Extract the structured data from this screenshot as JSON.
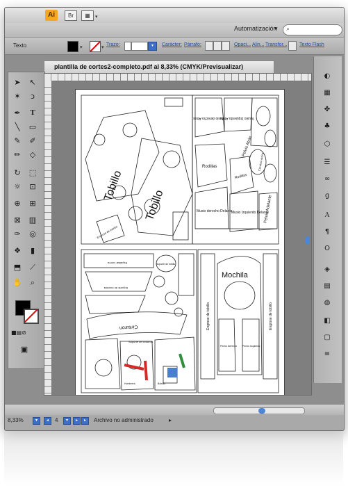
{
  "app": {
    "logo": "Ai",
    "br_label": "Br"
  },
  "menubar": {
    "workspace": "Automatización",
    "workspace_arrow": "▾"
  },
  "controlbar": {
    "context_label": "Texto",
    "stroke_label": "Trazo:",
    "character_label": "Carácter:",
    "paragraph_label": "Párrafo:",
    "opacity_label": "Opaci...",
    "align_label": "Alin...",
    "transform_label": "Transfor...",
    "flash_label": "Texto Flash"
  },
  "document": {
    "tab_title": "plantilla de cortes2-completo.pdf al 8,33% (CMYK/Previsualizar)"
  },
  "artboard_labels": {
    "tobillo_1": "Tobillo",
    "tobillo_2": "Tobillo",
    "engrose_estribo": "Engrose de estribo",
    "musio_derecho_atras": "Musio derecho Atras",
    "musio_izquierdo_atras": "Musio Izquierdo Atras",
    "pelvis_atras": "Pelvis Atrás",
    "circulos_vacios": "Circulos vacios",
    "rodillas_1": "Rodillas",
    "rodillas_2": "Rodillas",
    "pelvis_adelante": "Pelvis Adelante",
    "musio_derecho_delante": "Musio derecho Delante",
    "musio_izquierdo_delante": "Musio Izquierdo Delante",
    "soporte_tobillo": "Soporte de tobillo",
    "engrose_tobillo_1": "Engrose de tobillo",
    "engrose_tobillo_2": "Engrose de tobillo",
    "mochila": "Mochila",
    "espaldar": "Espaldar correa",
    "soporte_mochila": "Soporte de mochila",
    "cinturon": "Cinturon",
    "soporte_cinturon": "Soporte de cinturon",
    "pecho_derecho": "Pecho Derecho",
    "pecho_izquierdo": "Pecho Izquierdo",
    "bolsillo": "Bolsillo",
    "hombrera": "Hombrera"
  },
  "status": {
    "zoom": "8,33%",
    "page_number": "4",
    "file_status": "Archivo no administrado"
  },
  "colors": {
    "fill": "#000000",
    "accent_blue": "#3d6fc6",
    "red_marker": "#d42a2a",
    "green_marker": "#2f8f3a"
  }
}
